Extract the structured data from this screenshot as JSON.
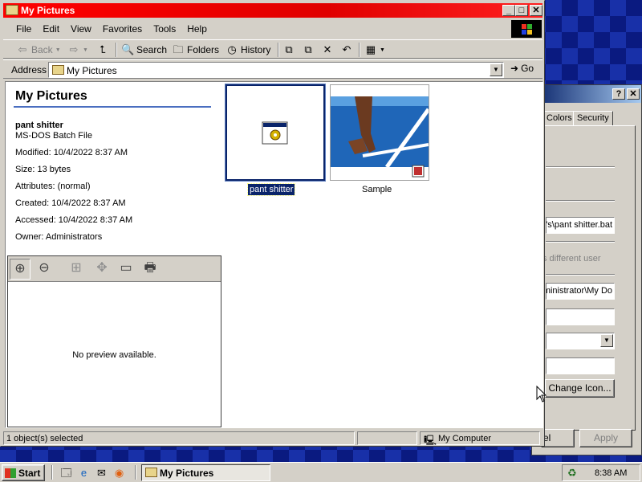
{
  "window": {
    "title": "My Pictures"
  },
  "menu": [
    "File",
    "Edit",
    "View",
    "Favorites",
    "Tools",
    "Help"
  ],
  "toolbar": {
    "back": "Back",
    "search": "Search",
    "folders": "Folders",
    "history": "History"
  },
  "address": {
    "label": "Address",
    "value": "My Pictures",
    "go": "Go"
  },
  "info": {
    "title": "My Pictures",
    "file_name": "pant shitter",
    "file_type": "MS-DOS Batch File",
    "modified": "Modified: 10/4/2022 8:37 AM",
    "size": "Size: 13 bytes",
    "attributes": "Attributes: (normal)",
    "created": "Created: 10/4/2022 8:37 AM",
    "accessed": "Accessed: 10/4/2022 8:37 AM",
    "owner": "Owner: Administrators",
    "no_preview": "No preview available."
  },
  "files": [
    {
      "name": "pant shitter",
      "icon": "batch-file-icon",
      "selected": true
    },
    {
      "name": "Sample",
      "icon": "image-thumbnail",
      "selected": false
    }
  ],
  "status": {
    "selected": "1 object(s) selected",
    "zone": "My Computer"
  },
  "dialog": {
    "tab_colors": "Colors",
    "tab_security": "Security",
    "target": "s\\pant shitter.bat\"",
    "run_as": "s different user",
    "start_in": "dministrator\\My Do",
    "change_icon": "Change Icon...",
    "cancel": "el",
    "apply": "Apply"
  },
  "taskbar": {
    "start": "Start",
    "task": "My Pictures",
    "clock": "8:38 AM"
  }
}
